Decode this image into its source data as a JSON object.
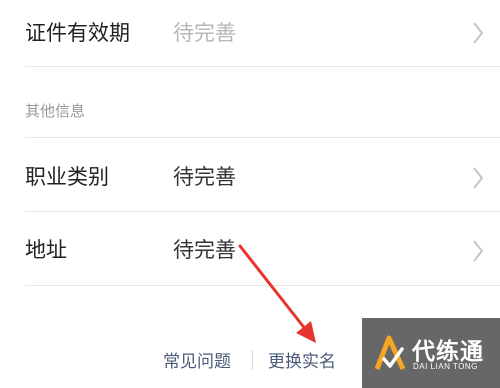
{
  "id_validity": {
    "label": "证件有效期",
    "value": "待完善"
  },
  "other_info": {
    "section_title": "其他信息",
    "occupation": {
      "label": "职业类别",
      "value": "待完善"
    },
    "address": {
      "label": "地址",
      "value": "待完善"
    }
  },
  "footer": {
    "faq_label": "常见问题",
    "change_name_label": "更换实名"
  },
  "watermark": {
    "title": "代练通",
    "subtitle": "DAI LIAN TONG"
  },
  "colors": {
    "annotation_arrow": "#e8342f",
    "link_text": "#4a5b7a",
    "muted_value": "#b7b7b7"
  }
}
